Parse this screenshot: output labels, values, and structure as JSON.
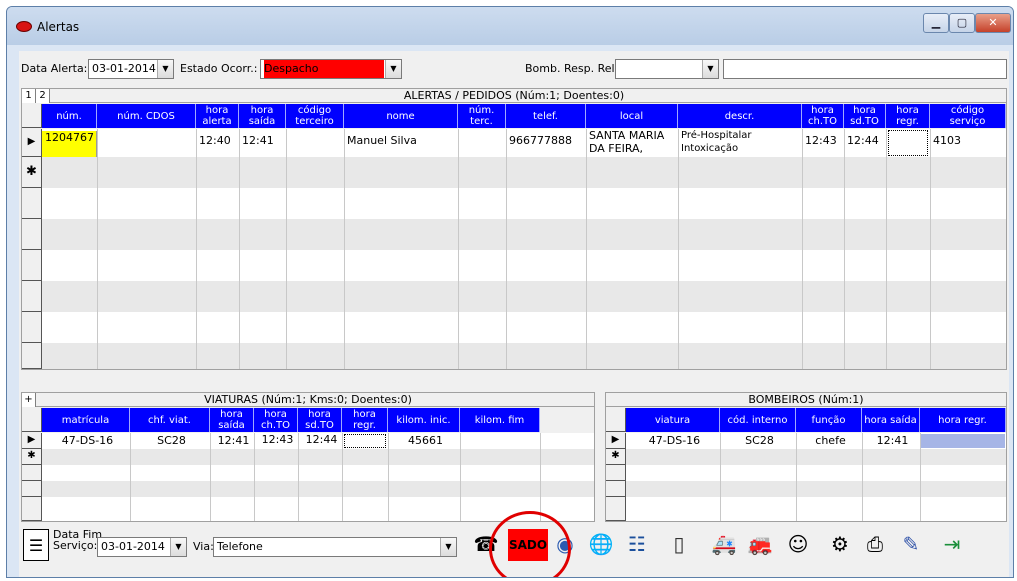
{
  "window": {
    "title": "Alertas"
  },
  "filters": {
    "data_alerta_label": "Data Alerta:",
    "data_alerta_value": "03-01-2014",
    "estado_label": "Estado Ocorr.:",
    "estado_value": "Despacho",
    "bomb_label": "Bomb. Resp. Rel.:",
    "bomb_value": ""
  },
  "alertas": {
    "tabs": [
      "1",
      "2"
    ],
    "caption": "ALERTAS / PEDIDOS (Núm:1;  Doentes:0)",
    "headers": [
      "núm.",
      "núm. CDOS",
      "hora alerta",
      "hora saída",
      "código terceiro",
      "nome",
      "núm. terc.",
      "telef.",
      "local",
      "descr.",
      "hora ch.TO",
      "hora sd.TO",
      "hora regr.",
      "código serviço"
    ],
    "row": {
      "num": "1204767",
      "num_cdos": "",
      "hora_alerta": "12:40",
      "hora_saida": "12:41",
      "codigo_terceiro": "",
      "nome": "Manuel Silva",
      "num_terc": "",
      "telef": "966777888",
      "local_1": "SANTA MARIA",
      "local_2": "DA FEIRA,",
      "descr_1": "Pré-Hospitalar",
      "descr_2": "Intoxicação",
      "hora_chto": "12:43",
      "hora_sdto": "12:44",
      "hora_regr": "",
      "codigo_servico": "4103"
    }
  },
  "viaturas": {
    "plus": "+",
    "caption": "VIATURAS (Núm:1;  Kms:0;  Doentes:0)",
    "headers": [
      "matrícula",
      "chf. viat.",
      "hora saída",
      "hora ch.TO",
      "hora sd.TO",
      "hora regr.",
      "kilom. inic.",
      "kilom. fim"
    ],
    "row": {
      "matricula": "47-DS-16",
      "chf": "SC28",
      "saida": "12:41",
      "chto": "12:43",
      "sdto": "12:44",
      "regr": "",
      "kinic": "45661",
      "kfim": ""
    }
  },
  "bombeiros": {
    "caption": "BOMBEIROS (Núm:1)",
    "headers": [
      "viatura",
      "cód. interno",
      "função",
      "hora saída",
      "hora regr."
    ],
    "row": {
      "viatura": "47-DS-16",
      "cod": "SC28",
      "funcao": "chefe",
      "saida": "12:41",
      "regr": ""
    }
  },
  "footer": {
    "data_fim_label_1": "Data Fim",
    "data_fim_label_2": "Serviço:",
    "data_fim_value": "03-01-2014",
    "via_label": "Via:",
    "via_value": "Telefone",
    "sado_label": "SADO"
  },
  "colors": {
    "header_blue": "#0000ff",
    "estado_red": "#ff0000",
    "highlight_yellow": "#ffff00"
  }
}
